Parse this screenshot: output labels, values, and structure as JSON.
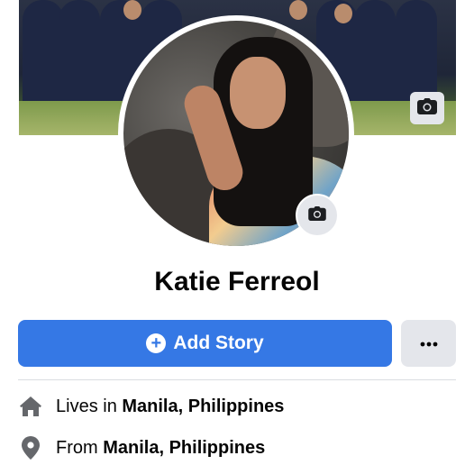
{
  "profile": {
    "name": "Katie Ferreol"
  },
  "actions": {
    "add_story_label": "Add Story",
    "more_label": "···"
  },
  "about": {
    "lives_prefix": "Lives in",
    "lives_place": "Manila, Philippines",
    "from_prefix": "From",
    "from_place": "Manila, Philippines"
  },
  "icons": {
    "cover_camera": "camera-icon",
    "avatar_camera": "camera-icon",
    "add": "plus-circle-icon",
    "home": "home-icon",
    "location": "location-pin-icon"
  },
  "colors": {
    "primary": "#3578e5",
    "secondary_button": "#e4e6eb",
    "text": "#050505",
    "icon": "#65676b"
  }
}
